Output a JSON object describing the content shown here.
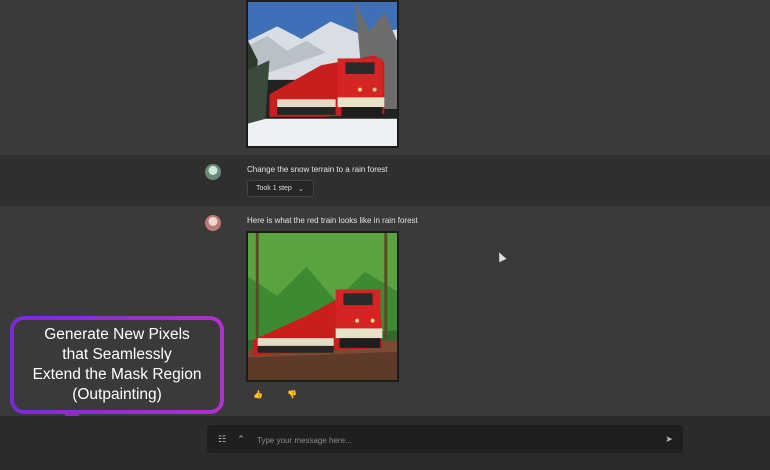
{
  "conversation": {
    "user_message": "Change the snow terrain to a rain forest",
    "step_pill": "Took 1 step",
    "assistant_message": "Here is what the red train looks like in rain forest",
    "thumbs_up_icon": "thumbs-up-icon",
    "thumbs_down_icon": "thumbs-down-icon"
  },
  "input": {
    "placeholder": "Type your message here...",
    "settings_icon": "sliders-icon",
    "expand_icon": "double-chevron-up-icon",
    "send_icon": "send-icon"
  },
  "callout": {
    "lines": [
      "Generate New Pixels",
      "that Seamlessly",
      "Extend the Mask Region",
      "(Outpainting)"
    ],
    "gradient": [
      "#7a2ad8",
      "#b22fd0"
    ]
  }
}
